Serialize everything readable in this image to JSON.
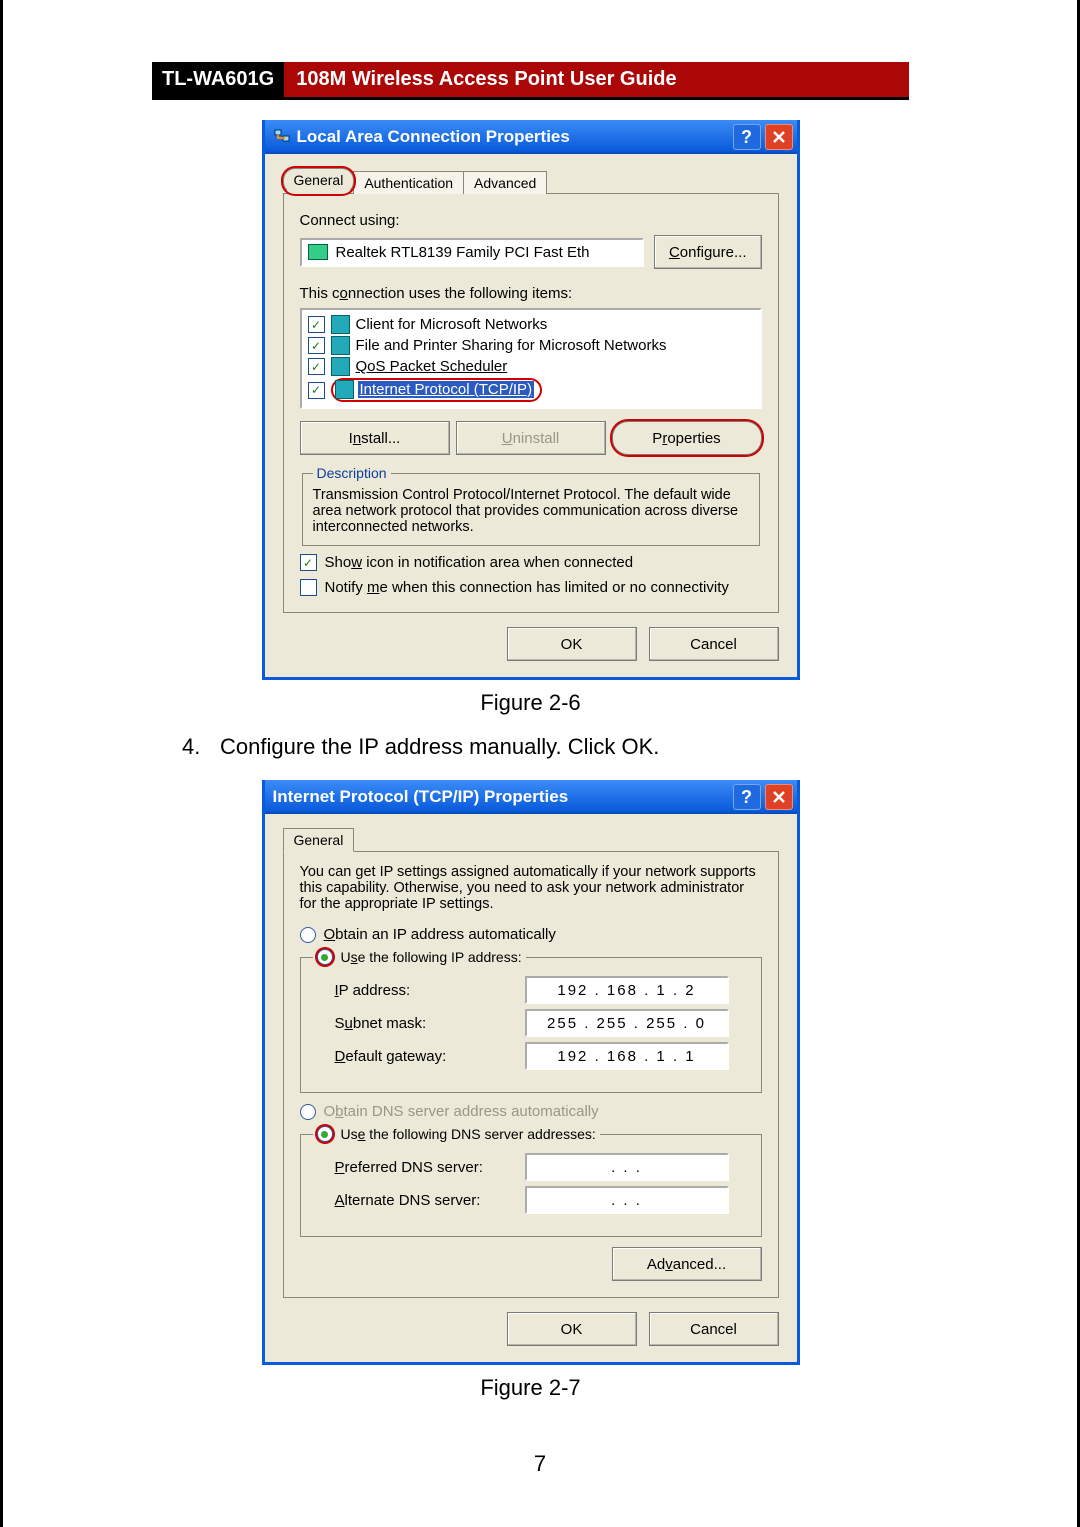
{
  "header": {
    "model": "TL-WA601G",
    "title": "108M Wireless Access Point User Guide"
  },
  "figure1_caption": "Figure 2-6",
  "figure2_caption": "Figure 2-7",
  "instruction": {
    "number": "4.",
    "text": "Configure the IP address manually. Click OK."
  },
  "page_number": "7",
  "dlg1": {
    "title": "Local Area Connection Properties",
    "tabs": [
      "General",
      "Authentication",
      "Advanced"
    ],
    "connect_using_label": "Connect using:",
    "adapter": "Realtek RTL8139 Family PCI Fast Eth",
    "configure_btn": "Configure...",
    "items_label": "This connection uses the following items:",
    "items": [
      "Client for Microsoft Networks",
      "File and Printer Sharing for Microsoft Networks",
      "QoS Packet Scheduler",
      "Internet Protocol (TCP/IP)"
    ],
    "install_btn": "Install...",
    "uninstall_btn": "Uninstall",
    "properties_btn": "Properties",
    "desc_label": "Description",
    "desc_text": "Transmission Control Protocol/Internet Protocol. The default wide area network protocol that provides communication across diverse interconnected networks.",
    "show_icon": "Show icon in notification area when connected",
    "notify": "Notify me when this connection has limited or no connectivity",
    "ok_btn": "OK",
    "cancel_btn": "Cancel"
  },
  "dlg2": {
    "title": "Internet Protocol (TCP/IP) Properties",
    "tab": "General",
    "intro": "You can get IP settings assigned automatically if your network supports this capability. Otherwise, you need to ask your network administrator for the appropriate IP settings.",
    "radio_auto_ip": "Obtain an IP address automatically",
    "radio_static_ip": "Use the following IP address:",
    "ip_label": "IP address:",
    "mask_label": "Subnet mask:",
    "gw_label": "Default gateway:",
    "ip": "192 . 168 .   1   .   2",
    "mask": "255 . 255 . 255 .   0",
    "gw": "192 . 168 .   1   .   1",
    "radio_auto_dns": "Obtain DNS server address automatically",
    "radio_static_dns": "Use the following DNS server addresses:",
    "pref_dns_label": "Preferred DNS server:",
    "alt_dns_label": "Alternate DNS server:",
    "pref_dns": ".          .          .",
    "alt_dns": ".          .          .",
    "advanced_btn": "Advanced...",
    "ok_btn": "OK",
    "cancel_btn": "Cancel"
  }
}
